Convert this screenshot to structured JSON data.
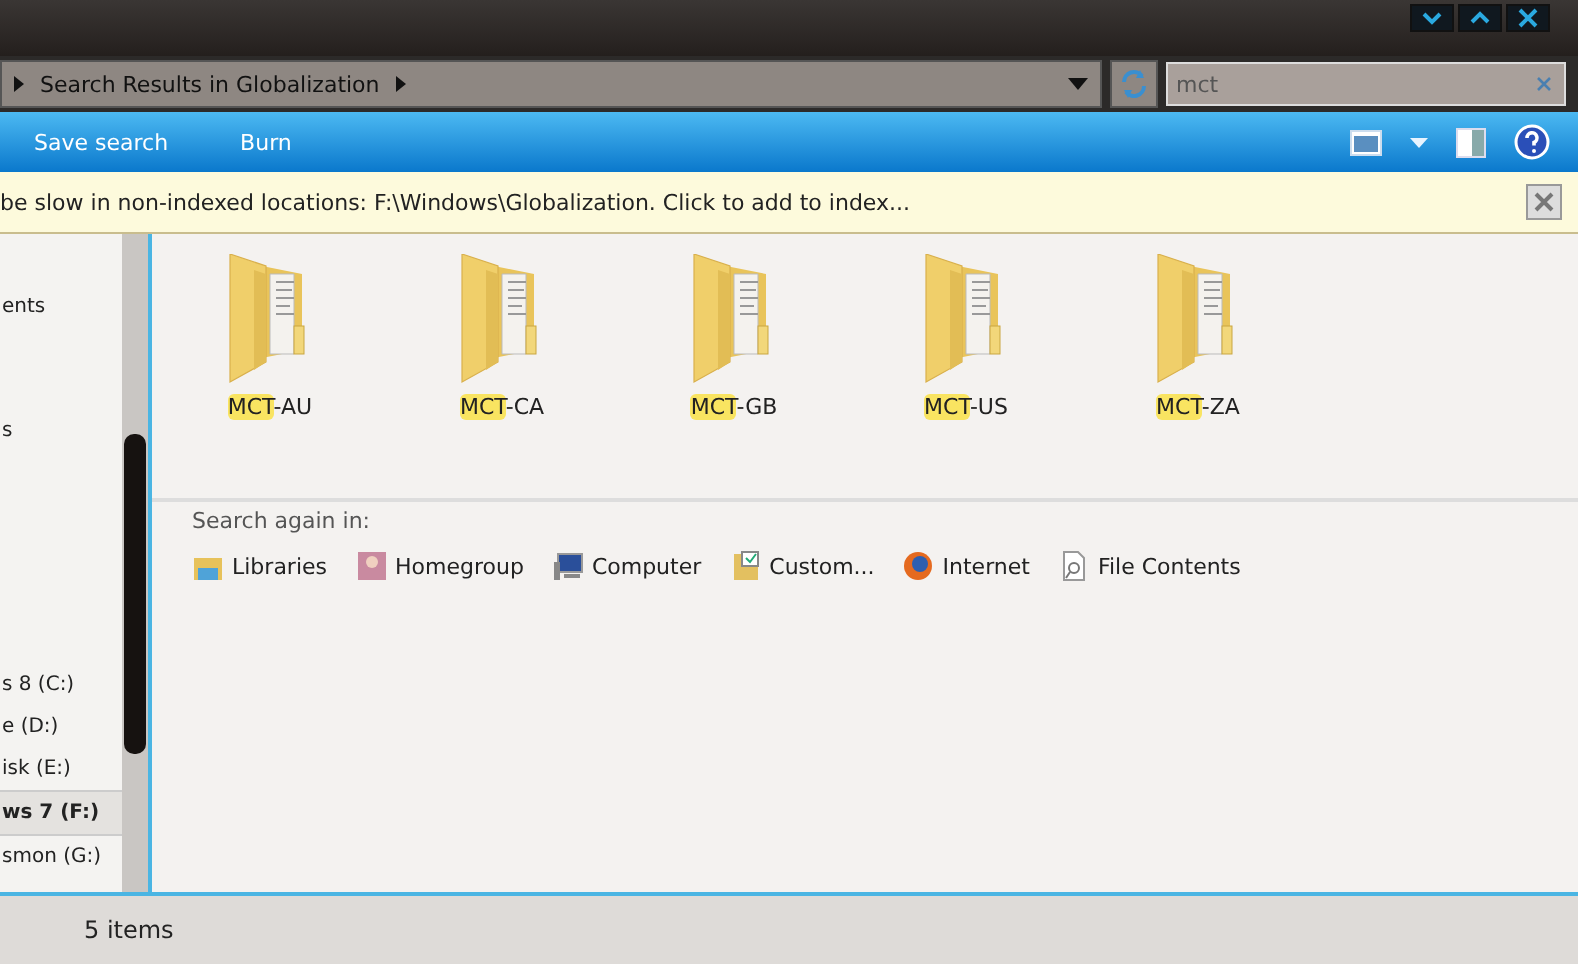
{
  "address": {
    "crumbs": [
      "Search Results in Globalization"
    ]
  },
  "search": {
    "value": "mct"
  },
  "toolbar": {
    "buttons": [
      "Save search",
      "Burn"
    ]
  },
  "infobar": {
    "text": "be slow in non-indexed locations: F:\\Windows\\Globalization. Click to add to index..."
  },
  "sidebar": {
    "items": [
      {
        "label": "ents",
        "selected": false
      },
      {
        "label": "s",
        "selected": false
      },
      {
        "label": "s 8 (C:)",
        "selected": false
      },
      {
        "label": "e (D:)",
        "selected": false
      },
      {
        "label": "isk (E:)",
        "selected": false
      },
      {
        "label": "ws 7 (F:)",
        "selected": true
      },
      {
        "label": "smon (G:)",
        "selected": false
      }
    ]
  },
  "results": [
    {
      "match": "MCT",
      "rest": "-AU"
    },
    {
      "match": "MCT",
      "rest": "-CA"
    },
    {
      "match": "MCT",
      "rest": "-GB"
    },
    {
      "match": "MCT",
      "rest": "-US"
    },
    {
      "match": "MCT",
      "rest": "-ZA"
    }
  ],
  "search_again": {
    "heading": "Search again in:",
    "locations": [
      {
        "label": "Libraries",
        "kind": "libraries"
      },
      {
        "label": "Homegroup",
        "kind": "homegroup"
      },
      {
        "label": "Computer",
        "kind": "computer"
      },
      {
        "label": "Custom...",
        "kind": "custom"
      },
      {
        "label": "Internet",
        "kind": "internet"
      },
      {
        "label": "File Contents",
        "kind": "contents"
      }
    ]
  },
  "status_bar": {
    "count": "5 items"
  }
}
